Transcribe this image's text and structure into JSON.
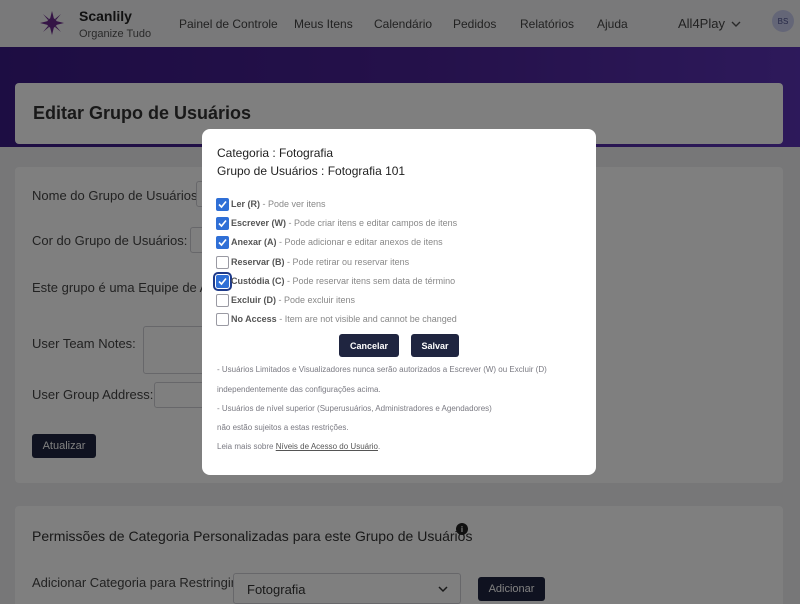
{
  "app": {
    "name": "Scanlily",
    "tagline": "Organize Tudo"
  },
  "nav": {
    "items": [
      "Painel de Controle",
      "Meus Itens",
      "Calendário",
      "Pedidos",
      "Relatórios",
      "Ajuda"
    ],
    "account": "All4Play",
    "avatar_initials": "BS"
  },
  "page": {
    "title": "Editar Grupo de Usuários"
  },
  "form": {
    "name_label": "Nome do Grupo de Usuários:",
    "color_label": "Cor do Grupo de Usuários:",
    "team_label": "Este grupo é uma Equipe de Açõ",
    "notes_label": "User Team Notes:",
    "address_label": "User Group Address:",
    "update_button": "Atualizar"
  },
  "permissions": {
    "title": "Permissões de Categoria Personalizadas para este Grupo de Usuários",
    "info_icon": "i",
    "add_label": "Adicionar Categoria para Restringir:",
    "selected_category": "Fotografia",
    "add_button": "Adicionar"
  },
  "modal": {
    "category_line": "Categoria : Fotografia",
    "group_line": "Grupo de Usuários : Fotografia 101",
    "options": [
      {
        "code": "Ler (R)",
        "desc": " - Pode ver itens",
        "checked": true
      },
      {
        "code": "Escrever (W)",
        "desc": " - Pode criar itens e editar campos de itens",
        "checked": true
      },
      {
        "code": "Anexar (A)",
        "desc": " - Pode adicionar e editar anexos de itens",
        "checked": true
      },
      {
        "code": "Reservar (B)",
        "desc": " - Pode retirar ou reservar itens",
        "checked": false
      },
      {
        "code": "Custódia (C)",
        "desc": " - Pode reservar itens sem data de término",
        "checked": true
      },
      {
        "code": "Excluir (D)",
        "desc": " - Pode excluir itens",
        "checked": false
      },
      {
        "code": "No Access",
        "desc": " - Item are not visible and cannot be changed",
        "checked": false
      }
    ],
    "cancel_button": "Cancelar",
    "save_button": "Salvar",
    "notes": [
      "- Usuários Limitados e Visualizadores nunca serão autorizados a Escrever (W) ou Excluir (D)",
      "independentemente das configurações acima.",
      "- Usuários de nível superior (Superusuários, Administradores e Agendadores)",
      "não estão sujeitos a estas restrições."
    ],
    "read_more_prefix": "Leia mais sobre ",
    "read_more_link": "Níveis de Acesso do Usuário",
    "read_more_suffix": "."
  },
  "colors": {
    "banner": "#4a2396",
    "button_dark": "#1f2540",
    "checkbox_checked": "#2f6fd6"
  }
}
